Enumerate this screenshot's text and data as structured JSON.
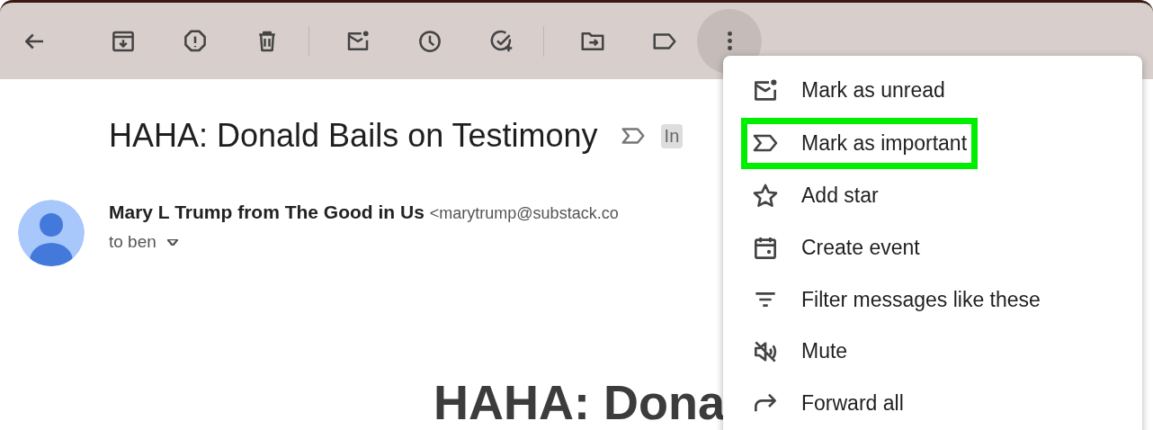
{
  "toolbar": {
    "more_selected": true
  },
  "subject": {
    "title": "HAHA: Donald Bails on Testimony",
    "important": false,
    "label": "In"
  },
  "sender": {
    "name": "Mary L Trump from The Good in Us",
    "email": "<marytrump@substack.co",
    "recipient": "to ben"
  },
  "body": {
    "headline": "HAHA: Dona"
  },
  "menu": {
    "items": [
      {
        "kind": "unread",
        "label": "Mark as unread",
        "selected": false
      },
      {
        "kind": "important",
        "label": "Mark as important",
        "selected": true
      },
      {
        "kind": "star",
        "label": "Add star",
        "selected": false
      },
      {
        "kind": "event",
        "label": "Create event",
        "selected": false
      },
      {
        "kind": "filter",
        "label": "Filter messages like these",
        "selected": false
      },
      {
        "kind": "mute",
        "label": "Mute",
        "selected": false
      },
      {
        "kind": "forward",
        "label": "Forward all",
        "selected": false
      }
    ]
  }
}
